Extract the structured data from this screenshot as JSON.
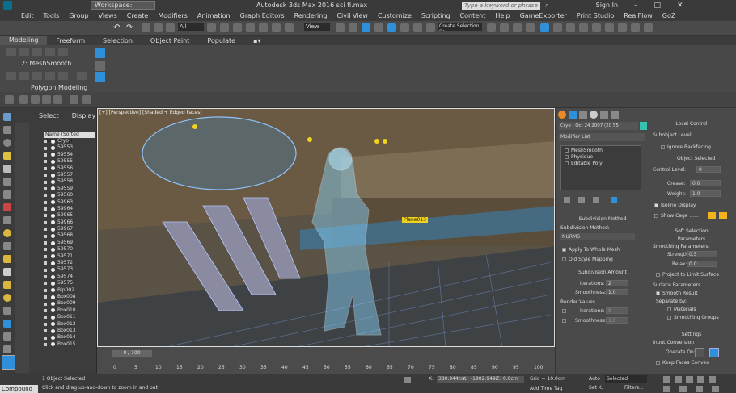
{
  "titlebar": {
    "workspace": "Workspace: Default",
    "title": "Autodesk 3ds Max 2016     sci fi.max",
    "search_placeholder": "Type a keyword or phrase",
    "signin": "Sign In"
  },
  "menu": [
    "Edit",
    "Tools",
    "Group",
    "Views",
    "Create",
    "Modifiers",
    "Animation",
    "Graph Editors",
    "Rendering",
    "Civil View",
    "Customize",
    "Scripting",
    "Content",
    "Help",
    "GameExporter",
    "Print Studio",
    "RealFlow",
    "GoZ"
  ],
  "toolbar": {
    "selection_filter": "All",
    "view_dropdown": "View",
    "named_selection": "Create Selection Se"
  },
  "ribbon": {
    "tabs": [
      "Modeling",
      "Freeform",
      "Selection",
      "Object Paint",
      "Populate"
    ],
    "active_tab": "Modeling",
    "modifier": "2: MeshSmooth",
    "panel_label": "Polygon Modeling"
  },
  "scene_explorer": {
    "tabs": [
      "Select",
      "Display"
    ],
    "header": "Name (Sorted Ascending)",
    "items": [
      "Cryo",
      "59553",
      "59554",
      "59555",
      "59556",
      "59557",
      "59558",
      "59559",
      "59560",
      "59963",
      "59964",
      "59965",
      "59966",
      "59967",
      "59568",
      "59569",
      "59570",
      "59571",
      "59572",
      "59573",
      "59574",
      "59575",
      "Bip002",
      "Box008",
      "Box009",
      "Box010",
      "Box011",
      "Box012",
      "Box013",
      "Box014",
      "Box015"
    ]
  },
  "viewport": {
    "label": "[+] [Perspective] [Shaded + Edged Faces]",
    "tag": "Plane013"
  },
  "timeline": {
    "frame": "0 / 100",
    "ticks": [
      "0",
      "5",
      "10",
      "15",
      "20",
      "25",
      "30",
      "35",
      "40",
      "45",
      "50",
      "55",
      "60",
      "65",
      "70",
      "75",
      "80",
      "85",
      "90",
      "95",
      "100"
    ]
  },
  "command_panel": {
    "object_name": "Cryo - Oct 24 2007 (20 55 23)-180x",
    "modifier_list": "Modifier List",
    "stack": [
      "MeshSmooth",
      "Physique",
      "Editable Poly"
    ],
    "subdivision_method": {
      "header": "Subdivision Method",
      "label": "Subdivision Method:",
      "value": "NURMS",
      "apply_whole": "Apply To Whole Mesh",
      "old_style": "Old Style Mapping"
    },
    "subdivision_amount": {
      "header": "Subdivision Amount",
      "iterations_label": "Iterations:",
      "iterations": "2",
      "smoothness_label": "Smoothness:",
      "smoothness": "1.0",
      "render_values": "Render Values",
      "r_iterations_label": "Iterations:",
      "r_iterations": "0",
      "r_smoothness_label": "Smoothness:",
      "r_smoothness": "1.0"
    }
  },
  "right_panel": {
    "local_control": "Local Control",
    "sub_object": "Subobject Level:",
    "ignore_backfacing": "Ignore Backfacing",
    "object_selected": "Object Selected",
    "control_level": "Control Level:",
    "control_level_val": "0",
    "crease": "Crease:",
    "crease_val": "0.0",
    "weight": "Weight:",
    "weight_val": "1.0",
    "isoline": "Isoline Display",
    "show_cage": "Show Cage ......",
    "soft_selection": "Soft Selection",
    "parameters": "Parameters",
    "smoothing_params": "Smoothing Parameters",
    "strength": "Strength:",
    "strength_val": "0.5",
    "relax": "Relax:",
    "relax_val": "0.0",
    "project_limit": "Project to Limit Surface",
    "surface_params": "Surface Parameters",
    "smooth_result": "Smooth Result",
    "separate_by": "Separate by:",
    "materials": "Materials",
    "smoothing_groups": "Smoothing Groups",
    "settings": "Settings",
    "input_conversion": "Input Conversion",
    "operate_on": "Operate On:",
    "keep_faces_convex": "Keep Faces Convex"
  },
  "status": {
    "selected": "1 Object Selected",
    "prompt": "Click and drag up-and-down to zoom in and out",
    "grid": "Grid = 10.0cm",
    "add_time_tag": "Add Time Tag",
    "auto": "Auto",
    "selected_dd": "Selected",
    "set_k": "Set K.",
    "filters": "Filters...",
    "compound": "Compound",
    "x_val": "380.944cm",
    "y_val": "-1902.949c",
    "z_val": "0.0cm"
  },
  "colors": {
    "accent": "#2f8fd8",
    "viewport_border": "#dddddd",
    "plane_tag": "#f1d21f",
    "cage_color1": "#f3b31b",
    "cage_color2": "#f3b31b"
  }
}
